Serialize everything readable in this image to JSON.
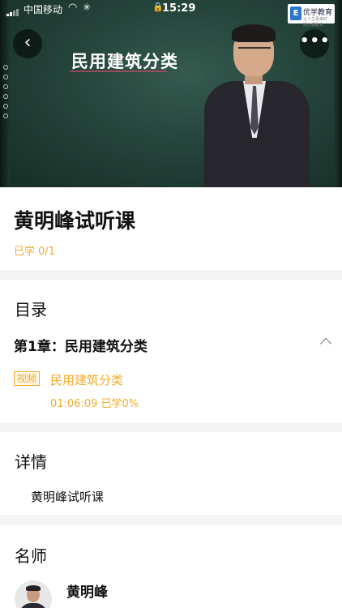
{
  "status_bar": {
    "carrier": "中国移动",
    "time": "15:29"
  },
  "video": {
    "board_title": "民用建筑分类",
    "logo_text": "优学教育",
    "logo_mark": "E",
    "logo_subtext": "让人生更美好 · 把心做教育",
    "back_icon": "chevron-left-icon",
    "more_icon": "more-icon"
  },
  "course": {
    "title": "黄明峰试听课",
    "progress": "已学 0/1"
  },
  "toc": {
    "heading": "目录",
    "chapter": "第1章：民用建筑分类",
    "lesson": {
      "badge": "视频",
      "title": "民用建筑分类",
      "duration": "01:06:09",
      "progress": "已学0%"
    }
  },
  "details": {
    "heading": "详情",
    "text": "黄明峰试听课"
  },
  "teachers": {
    "heading": "名师",
    "name": "黄明峰"
  },
  "colors": {
    "accent": "#f0ad2e",
    "board": "#24443b"
  }
}
